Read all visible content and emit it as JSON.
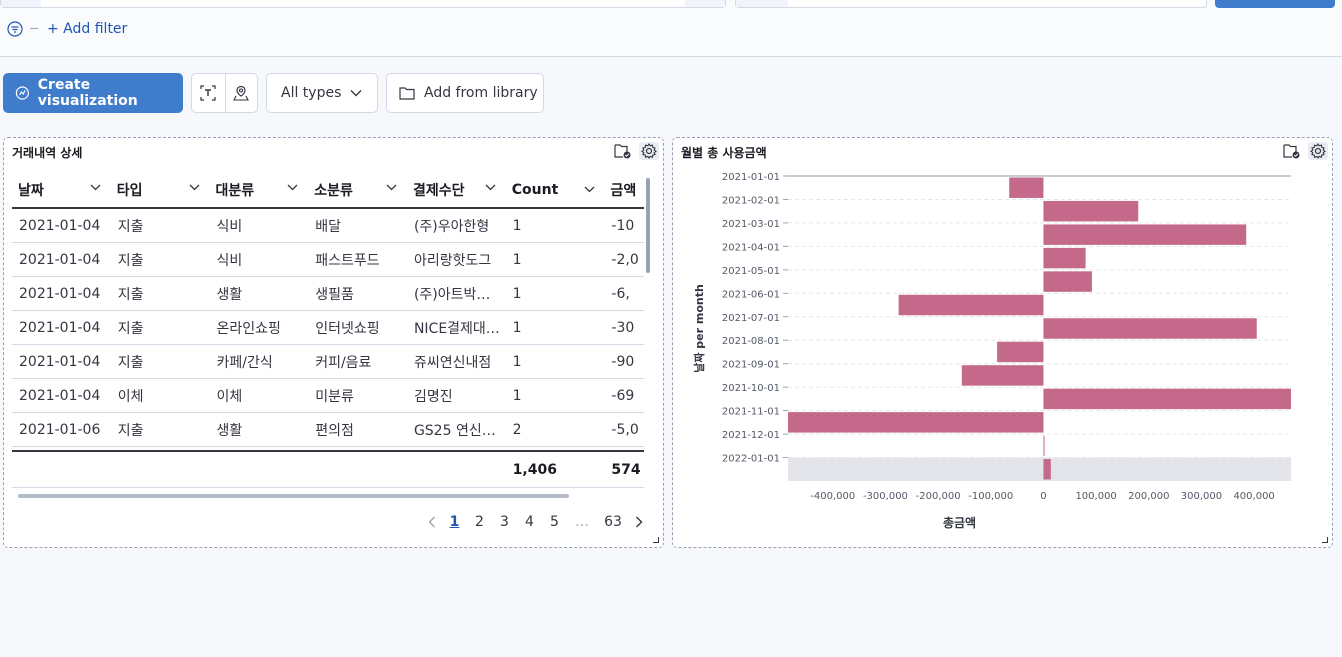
{
  "filters": {
    "add_filter_label": "+ Add filter"
  },
  "toolbar": {
    "create_label": "Create visualization",
    "types_label": "All types",
    "library_label": "Add from library"
  },
  "table_panel": {
    "title": "거래내역 상세",
    "columns": [
      "날짜",
      "타입",
      "대분류",
      "소분류",
      "결제수단",
      "Count",
      "금액"
    ],
    "rows": [
      [
        "2021-01-04",
        "지출",
        "식비",
        "배달",
        "(주)우아한형",
        "1",
        "-10"
      ],
      [
        "2021-01-04",
        "지출",
        "식비",
        "패스트푸드",
        "아리랑핫도그",
        "1",
        "-2,0"
      ],
      [
        "2021-01-04",
        "지출",
        "생활",
        "생필품",
        "(주)아트박…",
        "1",
        "-6,"
      ],
      [
        "2021-01-04",
        "지출",
        "온라인쇼핑",
        "인터넷쇼핑",
        "NICE결제대…",
        "1",
        "-30"
      ],
      [
        "2021-01-04",
        "지출",
        "카페/간식",
        "커피/음료",
        "쥬씨연신내점",
        "1",
        "-90"
      ],
      [
        "2021-01-04",
        "이체",
        "이체",
        "미분류",
        "김명진",
        "1",
        "-69"
      ],
      [
        "2021-01-06",
        "지출",
        "생활",
        "편의점",
        "GS25 연신…",
        "2",
        "-5,0"
      ]
    ],
    "footer": [
      "",
      "",
      "",
      "",
      "",
      "1,406",
      "574"
    ],
    "pagination": {
      "pages": [
        "1",
        "2",
        "3",
        "4",
        "5"
      ],
      "ellipsis": "…",
      "last": "63",
      "current": "1"
    }
  },
  "chart_panel": {
    "title": "월별 총 사용금액"
  },
  "chart_data": {
    "type": "bar",
    "orientation": "horizontal",
    "title": "월별 총 사용금액",
    "xlabel": "총금액",
    "ylabel": "날짜 per month",
    "categories": [
      "2021-01-01",
      "2021-02-01",
      "2021-03-01",
      "2021-04-01",
      "2021-05-01",
      "2021-06-01",
      "2021-07-01",
      "2021-08-01",
      "2021-09-01",
      "2021-10-01",
      "2021-11-01",
      "2021-12-01",
      "2022-01-01"
    ],
    "values": [
      -65000,
      180000,
      385000,
      80000,
      92000,
      -275000,
      405000,
      -88000,
      -155000,
      470000,
      -485000,
      2000,
      14000
    ],
    "xlim": [
      -485000,
      470000
    ],
    "xticks": [
      -400000,
      -300000,
      -200000,
      -100000,
      0,
      100000,
      200000,
      300000,
      400000
    ],
    "xtick_labels": [
      "-400,000",
      "-300,000",
      "-200,000",
      "-100,000",
      "0",
      "100,000",
      "200,000",
      "300,000",
      "400,000"
    ],
    "bar_color": "#c4698a",
    "grid": true
  }
}
